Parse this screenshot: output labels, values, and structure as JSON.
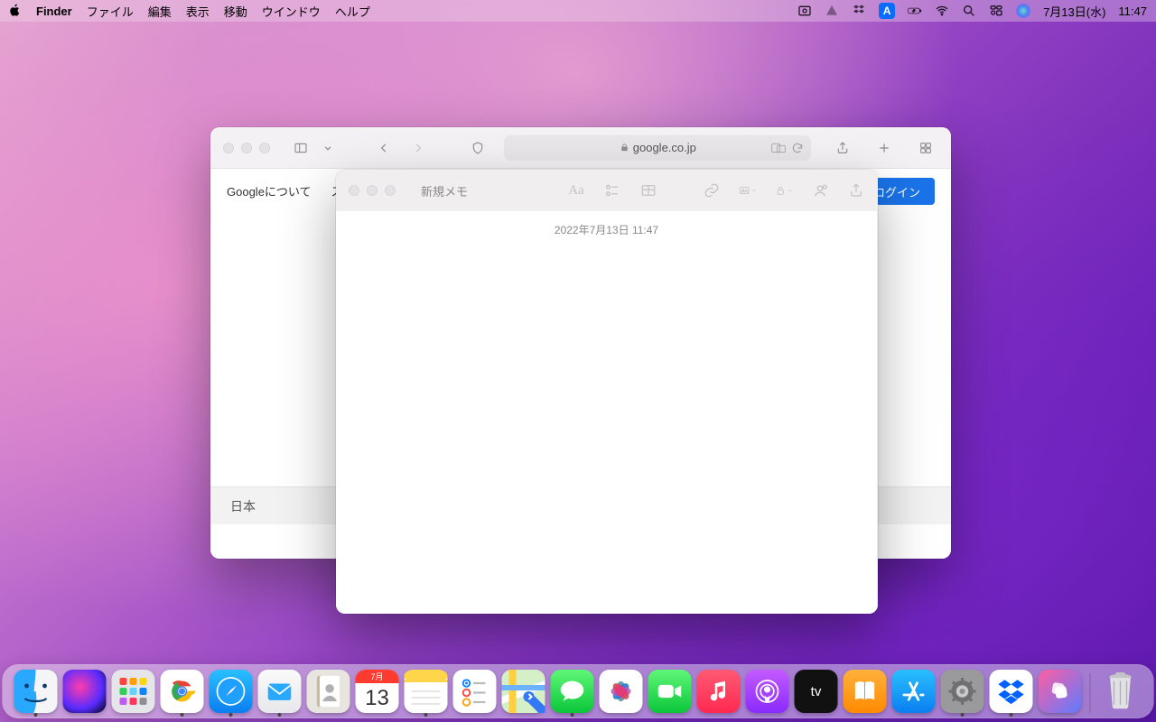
{
  "menubar": {
    "app_name": "Finder",
    "items": [
      "ファイル",
      "編集",
      "表示",
      "移動",
      "ウインドウ",
      "ヘルプ"
    ],
    "input_source": "A",
    "date": "7月13日(水)",
    "time": "11:47"
  },
  "safari": {
    "url": "google.co.jp",
    "google_about": "Googleについて",
    "google_store": "ス",
    "login_label": "ログイン",
    "footer_country": "日本"
  },
  "notes": {
    "title": "新規メモ",
    "timestamp": "2022年7月13日 11:47",
    "format_label": "Aa"
  },
  "dock": {
    "calendar_month": "7月",
    "calendar_day": "13",
    "apps": [
      "finder",
      "siri",
      "launchpad",
      "chrome",
      "safari",
      "mail",
      "contacts",
      "calendar",
      "notes",
      "reminders",
      "maps",
      "messages",
      "photos",
      "facetime",
      "music",
      "podcasts",
      "tv",
      "books",
      "appstore",
      "settings",
      "dropbox",
      "shortcuts"
    ],
    "running": [
      "finder",
      "chrome",
      "safari",
      "mail",
      "notes",
      "messages",
      "settings",
      "dropbox"
    ]
  }
}
